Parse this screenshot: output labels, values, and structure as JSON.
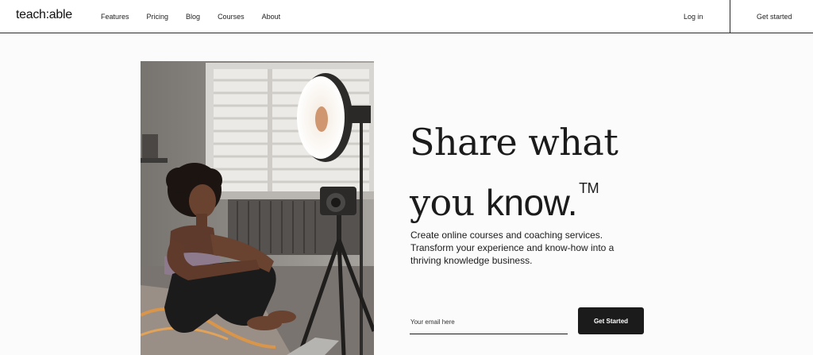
{
  "header": {
    "logo": "teach:able",
    "nav": [
      "Features",
      "Pricing",
      "Blog",
      "Courses",
      "About"
    ],
    "login_label": "Log in",
    "get_started_label": "Get started"
  },
  "hero": {
    "headline_line1": "Share what",
    "headline_line2_a": "you ",
    "headline_line2_b": "know.",
    "trademark": "TM",
    "subtext": "Create online courses and coaching services. Transform your experience and know-how into a thriving knowledge business.",
    "email_placeholder": "Your email here",
    "cta_label": "Get Started"
  }
}
